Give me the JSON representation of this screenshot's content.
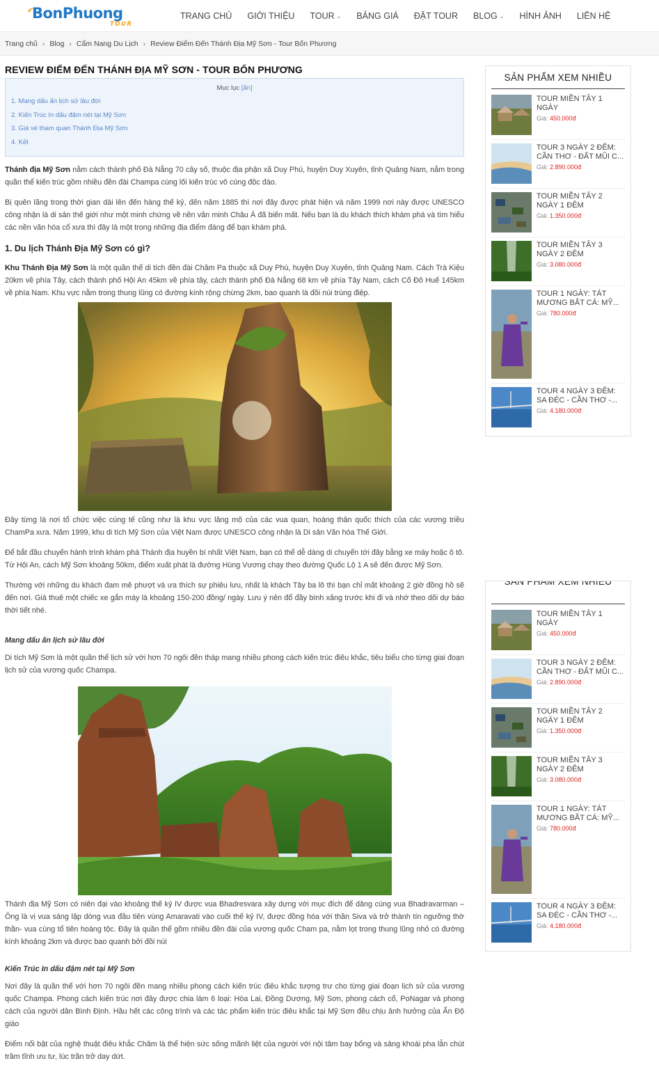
{
  "header": {
    "logo_main": "BonPhuong",
    "logo_sub": "TOUR",
    "nav": [
      {
        "label": "TRANG CHỦ",
        "has_dropdown": false
      },
      {
        "label": "GIỚI THIỆU",
        "has_dropdown": false
      },
      {
        "label": "TOUR",
        "has_dropdown": true
      },
      {
        "label": "BẢNG GIÁ",
        "has_dropdown": false
      },
      {
        "label": "ĐẶT TOUR",
        "has_dropdown": false
      },
      {
        "label": "BLOG",
        "has_dropdown": true
      },
      {
        "label": "HÌNH ẢNH",
        "has_dropdown": false
      },
      {
        "label": "LIÊN HỆ",
        "has_dropdown": false
      }
    ]
  },
  "breadcrumb": [
    "Trang chủ",
    "Blog",
    "Cẩm Nang Du Lịch",
    "Review Điểm Đến Thánh Địa Mỹ Sơn - Tour Bốn Phương"
  ],
  "article": {
    "title": "REVIEW ĐIỂM ĐẾN THÁNH ĐỊA MỸ SƠN - TOUR BỐN PHƯƠNG",
    "toc": {
      "heading": "Mục lục",
      "toggle": "[ẩn]",
      "items": [
        "1. Mang dấu ấn lịch sử lâu đời",
        "2. Kiến Trúc In dấu đậm nét tại Mỹ Sơn",
        "3. Giá vé tham quan Thánh Địa Mỹ Sơn",
        "4. Kết"
      ]
    },
    "intro_bold": "Thánh địa Mỹ Sơn",
    "intro_rest": " nằm cách thành phố Đà Nẵng 70 cây số, thuộc địa phận xã Duy Phú, huyện Duy Xuyên, tỉnh Quảng Nam, nằm trong quần thể kiến trúc gồm nhiều đền đài Champa cùng lối kiến trúc vô cùng độc đáo.",
    "p2": "Bị quên lãng trong thời gian dài lên đến hàng thế kỷ, đến năm 1885 thì nơi đây được phát hiện và năm 1999 nơi này được UNESCO công nhận là di sản thế giới như một minh chứng về nền văn minh Châu Á đã biến mất. Nếu bạn là du khách thích khám phá và tìm hiểu các nền văn hóa cổ xưa thì đây là một trong những địa điểm đáng để bạn khám phá.",
    "h2_1": "1. Du lịch Thánh Địa Mỹ Sơn có gì?",
    "p3_bold": "Khu Thánh Địa Mỹ Sơn",
    "p3_rest": " là một quần thể di tích đền đài Chăm Pa thuộc xã Duy Phú, huyện Duy Xuyên, tỉnh Quảng Nam. Cách Trà Kiệu 20km về phía Tây, cách thành phố Hội An 45km về phía tây, cách thành phố Đà Nẵng 68 km về phía Tây Nam, cách Cố Đô Huế 145km về phía Nam. Khu vực nằm trong thung lũng có đường kính rộng chừng 2km, bao quanh là đồi núi trùng điệp.",
    "p4": "Đây từng là nơi tổ chức việc cúng tế cũng như là khu vực lăng mộ của các vua quan, hoàng thân quốc thích của các vương triều ChamPa xưa. Năm 1999, khu di tích Mỹ Sơn của Việt Nam được UNESCO công nhận là Di sản Văn hóa Thế Giới.",
    "p5": "Để bắt đầu chuyến hành trình khám phá Thánh địa huyền bí nhất Việt Nam, bạn có thể dễ dàng di chuyển tới đây bằng xe máy hoặc ô tô. Từ Hội An, cách Mỹ Sơn khoảng 50km, điểm xuất phát là đường Hùng Vương chạy theo đường Quốc Lộ 1 A sẽ đến được Mỹ Sơn.",
    "p6": "Thường với những du khách đam mê phượt và ưa thích sự phiêu lưu, nhất là khách Tây ba lô thì bạn chỉ mất khoảng 2 giờ đồng hồ sẽ đến nơi. Giá thuê một chiếc xe gắn máy là khoảng 150-200 đồng/ ngày. Lưu ý nên đổ đầy bình xăng trước khi đi và nhớ theo dõi dự báo thời tiết nhé.",
    "h3_1": "Mang dấu ấn lịch sử lâu đời",
    "p7": "Di tích Mỹ Sơn là một quần thể lịch sử với hơn 70 ngôi đền tháp mang nhiều phong cách kiến trúc điêu khắc, tiêu biểu cho từng giai đoạn lịch sử của vương quốc Champa.",
    "p8": "Thánh địa Mỹ Sơn có niên đại vào khoảng thế kỷ IV được vua Bhadresvara xây dựng với mục đích để dâng cúng vua Bhadravarman – Ông là vị vua sáng lập dòng vua đầu tiên vùng Amaravati vào cuối thế kỷ IV, được đồng hóa với thần Siva và trở thành tín ngưỡng thờ thần- vua cùng tổ tiên hoàng tộc. Đây là quần thể gồm nhiều đền đài của vương quốc Cham pa, nằm lọt trong thung lũng nhỏ có đường kính khoảng 2km và được bao quanh bởi đồi núi",
    "h3_2": "Kiến Trúc In dấu đậm nét tại Mỹ Sơn",
    "p9": "Nơi đây là quần thể với hơn 70 ngôi đền mang nhiều phong cách kiến trúc điêu khắc tượng trư cho từng giai đoạn lịch sử của vương quốc Champa. Phong cách kiến trúc nơi đây được chia làm 6 loại: Hòa Lai, Đồng Dương, Mỹ Sơn, phong cách cổ, PoNagar và phong cách của người dân Bình Định. Hầu hết các công trình và các tác phẩm kiến trúc điêu khắc tại Mỹ Sơn đều chịu ảnh hưởng của Ấn Độ giáo",
    "p10": "Điểm nổi bật của nghệ thuật điêu khắc Chăm là thể hiện sức sống mãnh liệt của người với nội tâm bay bổng và sảng khoái pha lẫn chút trầm tĩnh ưu tư, lúc trần trở day dứt."
  },
  "sidebar": {
    "title": "SẢN PHẨM XEM NHIỀU",
    "price_label": "Giá:",
    "items": [
      {
        "name": "TOUR MIỀN TÂY 1 NGÀY",
        "price": "450.000đ",
        "thumb": "village"
      },
      {
        "name": "TOUR 3 NGÀY 2 ĐÊM: CẦN THƠ - ĐẤT MŨI C...",
        "price": "2.890.000đ",
        "thumb": "beach"
      },
      {
        "name": "TOUR MIỀN TÂY 2 NGÀY 1 ĐÊM",
        "price": "1.350.000đ",
        "thumb": "boats"
      },
      {
        "name": "TOUR MIỀN TÂY 3 NGÀY 2 ĐÊM",
        "price": "3.080.000đ",
        "thumb": "river"
      },
      {
        "name": "TOUR 1 NGÀY: TÁT MƯƠNG BẮT CÁ: MỸ...",
        "price": "780.000đ",
        "thumb": "fisher"
      },
      {
        "name": "TOUR 4 NGÀY 3 ĐÊM: SA ĐÉC - CẦN THƠ -...",
        "price": "4.180.000đ",
        "thumb": "bridge"
      }
    ]
  },
  "colors": {
    "price": "#e02020",
    "toc_link": "#5b86c8",
    "logo_blue": "#1f78c8",
    "logo_orange": "#f2a31b"
  }
}
